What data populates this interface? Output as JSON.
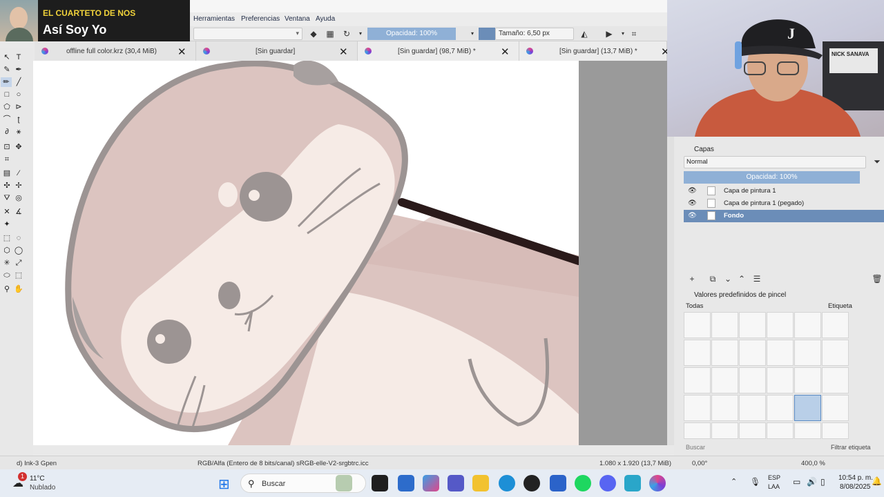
{
  "overlay": {
    "label": "EL CUARTETO DE NOS",
    "song": "Así Soy Yo"
  },
  "menu": [
    "Herramientas",
    "Preferencias",
    "Ventana",
    "Ayuda"
  ],
  "toolbar": {
    "opacity": "Opacidad: 100%",
    "size": "Tamaño: 6,50 px"
  },
  "tabs": [
    {
      "label": "offline full color.krz (30,4 MiB)"
    },
    {
      "label": "[Sin guardar]"
    },
    {
      "label": "[Sin guardar] (98,7 MiB) *"
    },
    {
      "label": "[Sin guardar] (13,7 MiB) *"
    }
  ],
  "layers_panel": {
    "title": "Capas",
    "blend_mode": "Normal",
    "opacity": "Opacidad:  100%",
    "layers": [
      {
        "name": "Capa de pintura 1",
        "selected": false
      },
      {
        "name": "Capa de pintura 1 (pegado)",
        "selected": false
      },
      {
        "name": "Fondo",
        "selected": true
      }
    ]
  },
  "brush_panel": {
    "title": "Valores predefinidos de pincel",
    "filter": "Todas",
    "tag_label": "Etiqueta",
    "search_placeholder": "Buscar",
    "filter_tag": "Filtrar etiqueta"
  },
  "status": {
    "brush_name": "d) Ink-3 Gpen",
    "color_space": "RGB/Alfa (Entero de 8 bits/canal)  sRGB-elle-V2-srgbtrc.icc",
    "image_size": "1.080 x 1.920 (13,7 MiB)",
    "rotation": "0,00°",
    "zoom": "400,0 %"
  },
  "taskbar": {
    "weather_temp": "11°C",
    "weather_desc": "Nublado",
    "weather_badge": "1",
    "search_label": "Buscar",
    "lang1": "ESP",
    "lang2": "LAA",
    "time": "10:54 p. m.",
    "date": "8/08/2025"
  },
  "webcam": {
    "cap_letter": "J",
    "sticker_text": "NICK SANAVA"
  },
  "colors": {
    "accent": "#8fb0d6",
    "selected_row": "#6b8db8",
    "ink": "#2a1a1a"
  }
}
